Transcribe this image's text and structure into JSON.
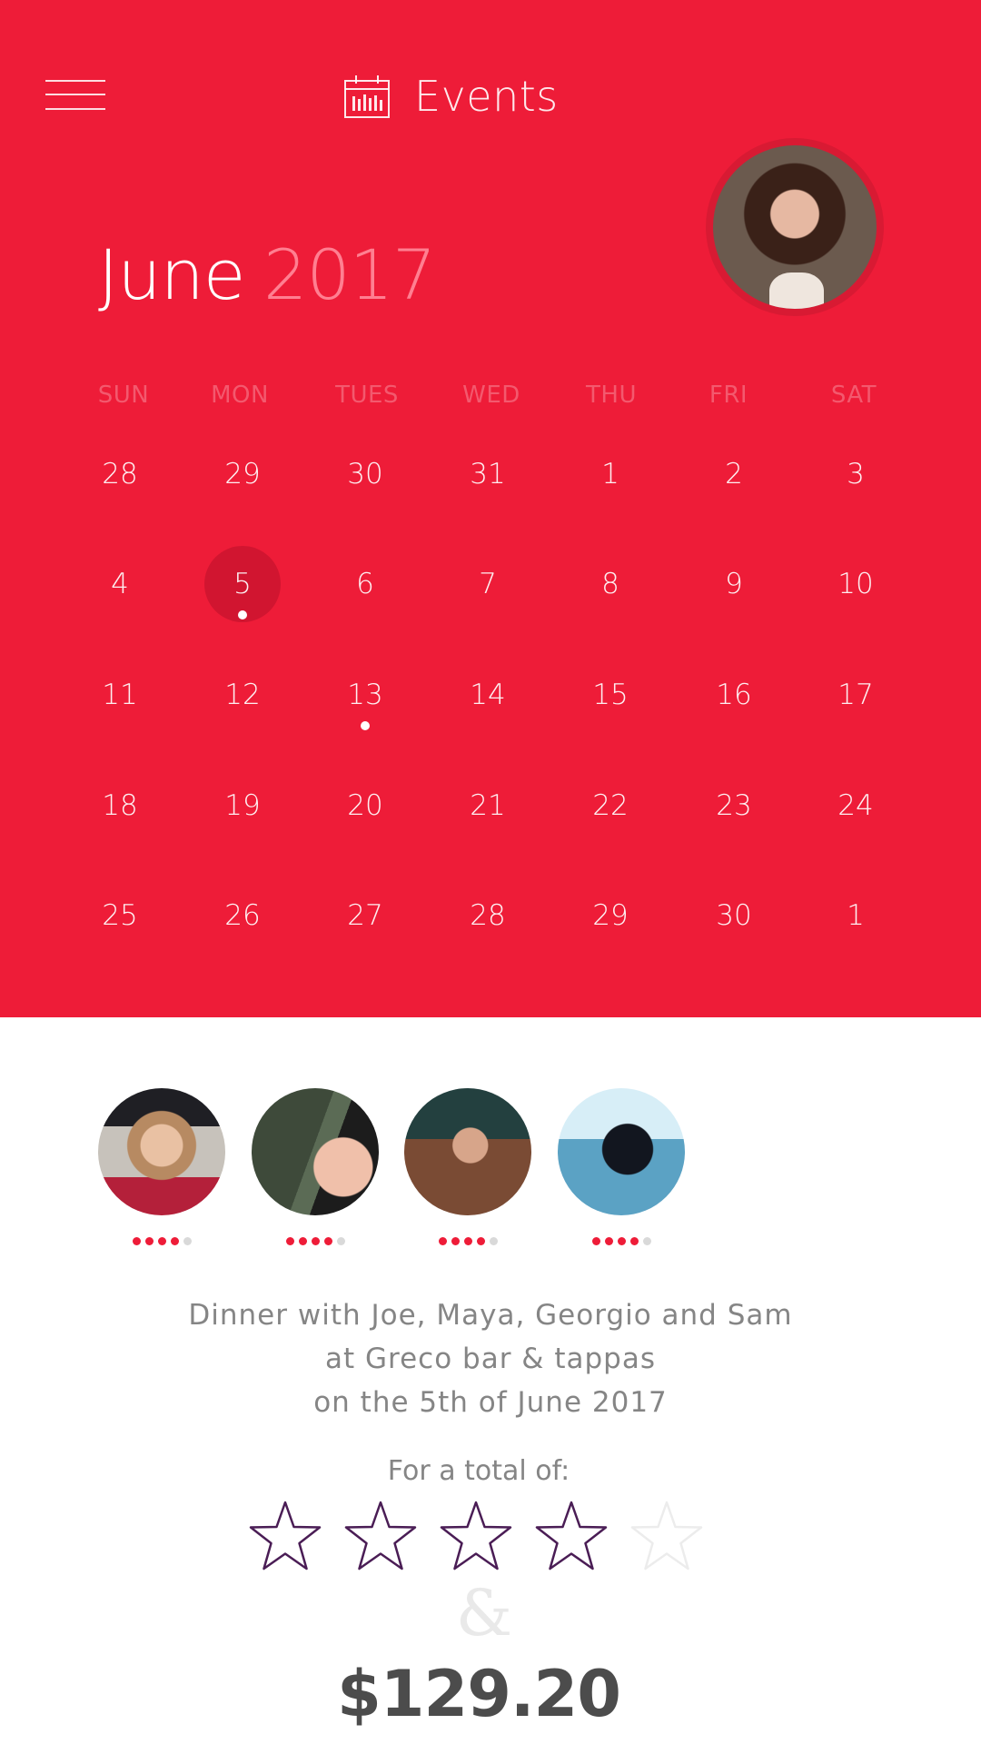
{
  "header": {
    "title": "Events",
    "menu_icon": "hamburger-menu-icon",
    "calendar_icon": "calendar-icon"
  },
  "calendar": {
    "month": "June",
    "year": "2017",
    "weekdays": [
      "SUN",
      "MON",
      "TUES",
      "WED",
      "THU",
      "FRI",
      "SAT"
    ],
    "weeks": [
      [
        "28",
        "29",
        "30",
        "31",
        "1",
        "2",
        "3"
      ],
      [
        "4",
        "5",
        "6",
        "7",
        "8",
        "9",
        "10"
      ],
      [
        "11",
        "12",
        "13",
        "14",
        "15",
        "16",
        "17"
      ],
      [
        "18",
        "19",
        "20",
        "21",
        "22",
        "23",
        "24"
      ],
      [
        "25",
        "26",
        "27",
        "28",
        "29",
        "30",
        "1"
      ]
    ],
    "selected_day": "5",
    "event_days": [
      "5",
      "13"
    ]
  },
  "attendees": [
    {
      "name": "Joe",
      "rating": 4,
      "max": 5
    },
    {
      "name": "Maya",
      "rating": 4,
      "max": 5
    },
    {
      "name": "Georgio",
      "rating": 4,
      "max": 5
    },
    {
      "name": "Sam",
      "rating": 4,
      "max": 5
    }
  ],
  "event": {
    "line1": "Dinner with Joe, Maya, Georgio and Sam",
    "line2": "at Greco bar & tappas",
    "line3": "on the 5th of June 2017"
  },
  "total": {
    "label": "For a total of:",
    "stars": 4,
    "stars_max": 5,
    "ampersand": "&",
    "price": "$129.20"
  },
  "colors": {
    "accent": "#ee1c38",
    "star_filled": "#4a1d55",
    "star_empty": "#ececec"
  }
}
